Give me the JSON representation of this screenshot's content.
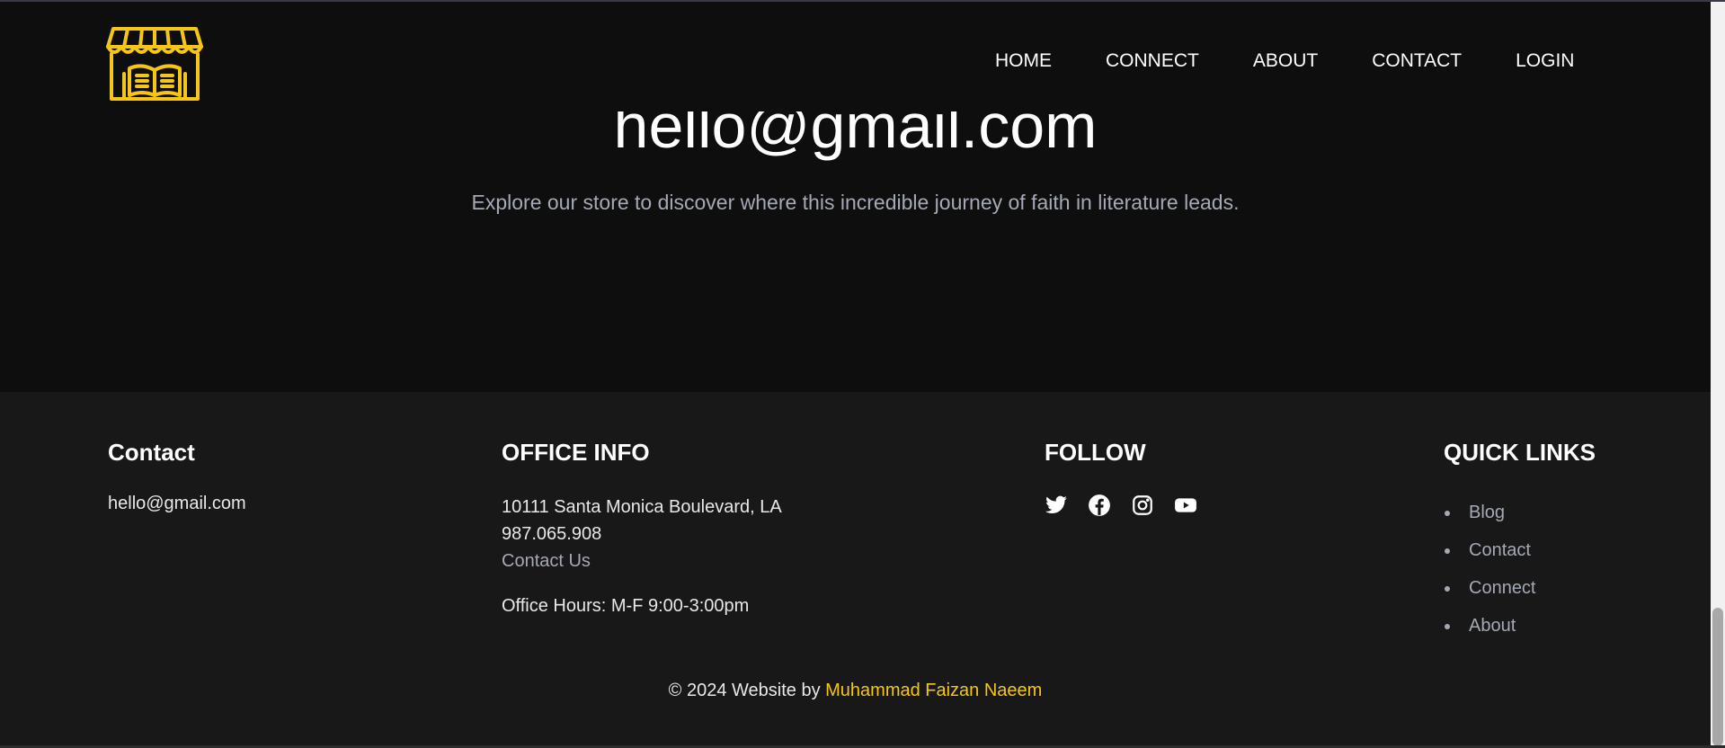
{
  "colors": {
    "accent": "#f5c518",
    "background": "#0e0e0e",
    "footer_background": "#181818",
    "muted_text": "#a4a9b5"
  },
  "header": {
    "logo_icon": "bookstore-icon",
    "nav": [
      {
        "label": "HOME"
      },
      {
        "label": "CONNECT"
      },
      {
        "label": "ABOUT"
      },
      {
        "label": "CONTACT"
      },
      {
        "label": "LOGIN"
      }
    ]
  },
  "hero": {
    "email": "hello@gmail.com",
    "tagline": "Explore our store to discover where this incredible journey of faith in literature leads."
  },
  "footer": {
    "contact": {
      "title": "Contact",
      "email": "hello@gmail.com"
    },
    "office": {
      "title": "OFFICE INFO",
      "address": "10111 Santa Monica Boulevard, LA",
      "phone": "987.065.908",
      "link": "Contact Us",
      "hours": "Office Hours: M-F 9:00-3:00pm"
    },
    "follow": {
      "title": "FOLLOW",
      "icons": [
        "twitter-icon",
        "facebook-icon",
        "instagram-icon",
        "youtube-icon"
      ]
    },
    "quick_links": {
      "title": "QUICK LINKS",
      "items": [
        {
          "label": "Blog"
        },
        {
          "label": "Contact"
        },
        {
          "label": "Connect"
        },
        {
          "label": "About"
        }
      ]
    },
    "copyright": {
      "prefix": "© 2024 Website by",
      "author": "Muhammad Faizan Naeem"
    }
  }
}
